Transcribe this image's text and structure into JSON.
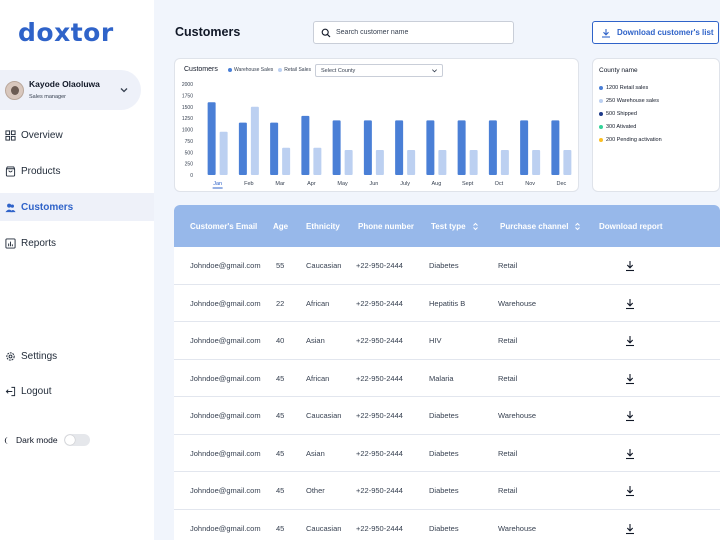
{
  "logo": {
    "text_a": "do",
    "text_x": "x",
    "text_b": "tor"
  },
  "user": {
    "name": "Kayode Olaoluwa",
    "role": "Sales manager"
  },
  "nav": {
    "overview": "Overview",
    "products": "Products",
    "customers": "Customers",
    "reports": "Reports",
    "settings": "Settings",
    "logout": "Logout"
  },
  "dark_mode": {
    "label": "Dark mode",
    "enabled": false
  },
  "header": {
    "title": "Customers",
    "search_placeholder": "Search customer name",
    "download_label": "Download customer's list"
  },
  "chart_card": {
    "title": "Customers",
    "select_label": "Select County"
  },
  "chart_data": {
    "type": "bar",
    "categories": [
      "Jan",
      "Feb",
      "Mar",
      "Apr",
      "May",
      "Jun",
      "July",
      "Aug",
      "Sept",
      "Oct",
      "Nov",
      "Dec"
    ],
    "series": [
      {
        "name": "Warehouse Sales",
        "color": "#4a7fd6",
        "values": [
          1600,
          1150,
          1150,
          1300,
          1200,
          1200,
          1200,
          1200,
          1200,
          1200,
          1200,
          1200
        ]
      },
      {
        "name": "Retail Sales",
        "color": "#bcd0f1",
        "values": [
          950,
          1500,
          600,
          600,
          550,
          550,
          550,
          550,
          550,
          550,
          550,
          550
        ]
      }
    ],
    "yticks": [
      0,
      250,
      500,
      750,
      1000,
      1250,
      1500,
      1750,
      2000
    ],
    "ylim": [
      0,
      2000
    ],
    "selected_category": "Jan",
    "grid": false,
    "legend_position": "top-left"
  },
  "county": {
    "title": "County name",
    "items": [
      {
        "label": "1200 Retail sales",
        "color": "#4a7fd6"
      },
      {
        "label": "250 Warehouse sales",
        "color": "#bcd0f1"
      },
      {
        "label": "500 Shipped",
        "color": "#1e3a8a"
      },
      {
        "label": "300 Ativated",
        "color": "#34d399"
      },
      {
        "label": "200 Pending activation",
        "color": "#fbbf24"
      }
    ]
  },
  "table": {
    "headers": {
      "email": "Customer's Email",
      "age": "Age",
      "ethnicity": "Ethnicity",
      "phone": "Phone number",
      "test": "Test type",
      "channel": "Purchase channel",
      "report": "Download report"
    },
    "rows": [
      {
        "email": "Johndoe@gmail.com",
        "age": "55",
        "ethnicity": "Caucasian",
        "phone": "+22-950-2444",
        "test": "Diabetes",
        "channel": "Retail"
      },
      {
        "email": "Johndoe@gmail.com",
        "age": "22",
        "ethnicity": "African",
        "phone": "+22-950-2444",
        "test": "Hepatitis B",
        "channel": "Warehouse"
      },
      {
        "email": "Johndoe@gmail.com",
        "age": "40",
        "ethnicity": "Asian",
        "phone": "+22-950-2444",
        "test": "HIV",
        "channel": "Retail"
      },
      {
        "email": "Johndoe@gmail.com",
        "age": "45",
        "ethnicity": "African",
        "phone": "+22-950-2444",
        "test": "Malaria",
        "channel": "Retail"
      },
      {
        "email": "Johndoe@gmail.com",
        "age": "45",
        "ethnicity": "Caucasian",
        "phone": "+22-950-2444",
        "test": "Diabetes",
        "channel": "Warehouse"
      },
      {
        "email": "Johndoe@gmail.com",
        "age": "45",
        "ethnicity": "Asian",
        "phone": "+22-950-2444",
        "test": "Diabetes",
        "channel": "Retail"
      },
      {
        "email": "Johndoe@gmail.com",
        "age": "45",
        "ethnicity": "Other",
        "phone": "+22-950-2444",
        "test": "Diabetes",
        "channel": "Retail"
      },
      {
        "email": "Johndoe@gmail.com",
        "age": "45",
        "ethnicity": "Caucasian",
        "phone": "+22-950-2444",
        "test": "Diabetes",
        "channel": "Warehouse"
      }
    ]
  },
  "colors": {
    "accent": "#2f63c9",
    "table_header": "#97b8ea"
  },
  "icons": {
    "user_chevron": "chevron-down-icon",
    "overview": "grid-icon",
    "products": "bag-icon",
    "customers": "users-icon",
    "reports": "chart-icon",
    "settings": "gear-icon",
    "logout": "logout-icon",
    "dark_mode": "moon-icon",
    "search": "search-icon",
    "download": "download-icon",
    "sort": "sort-icon",
    "row_download": "download-icon"
  }
}
